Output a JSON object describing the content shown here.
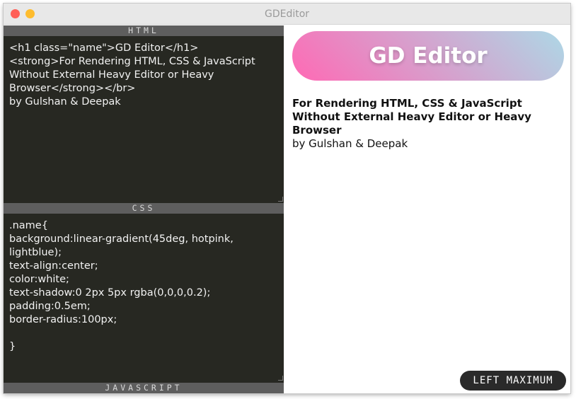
{
  "window": {
    "title": "GDEditor"
  },
  "html_pane": {
    "header": "HTML",
    "code": "<h1 class=\"name\">GD Editor</h1>\n<strong>For Rendering HTML, CSS & JavaScript Without External Heavy Editor or Heavy Browser</strong></br>\nby Gulshan & Deepak"
  },
  "css_pane": {
    "header": "CSS",
    "code": ".name{\nbackground:linear-gradient(45deg, hotpink, lightblue);\ntext-align:center;\ncolor:white;\ntext-shadow:0 2px 5px rgba(0,0,0,0.2);\npadding:0.5em;\nborder-radius:100px;\n\n}"
  },
  "js_pane": {
    "header": "JAVASCRIPT"
  },
  "preview": {
    "heading": "GD Editor",
    "subtitle": "For Rendering HTML, CSS & JavaScript Without External Heavy Editor or Heavy Browser",
    "byline": "by Gulshan & Deepak"
  },
  "toggle_button": {
    "label": "LEFT MAXIMUM"
  }
}
